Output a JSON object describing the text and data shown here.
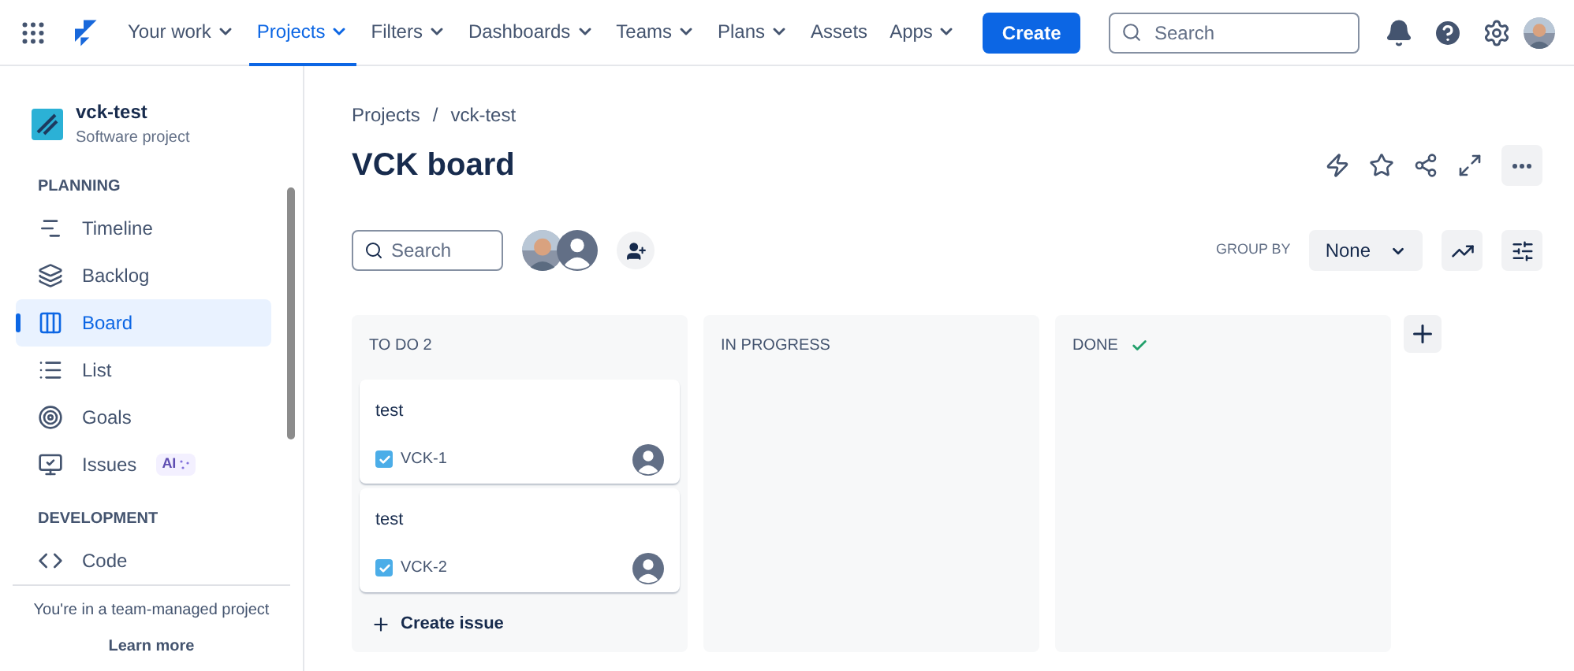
{
  "top_nav": {
    "items": [
      {
        "label": "Your work",
        "dropdown": true,
        "selected": false
      },
      {
        "label": "Projects",
        "dropdown": true,
        "selected": true
      },
      {
        "label": "Filters",
        "dropdown": true,
        "selected": false
      },
      {
        "label": "Dashboards",
        "dropdown": true,
        "selected": false
      },
      {
        "label": "Teams",
        "dropdown": true,
        "selected": false
      },
      {
        "label": "Plans",
        "dropdown": true,
        "selected": false
      },
      {
        "label": "Assets",
        "dropdown": false,
        "selected": false
      },
      {
        "label": "Apps",
        "dropdown": true,
        "selected": false
      }
    ],
    "create_button": "Create",
    "search": {
      "placeholder": "Search"
    }
  },
  "sidebar": {
    "project_name": "vck-test",
    "project_type": "Software project",
    "sections": [
      {
        "heading": "PLANNING",
        "items": [
          {
            "label": "Timeline",
            "selected": false
          },
          {
            "label": "Backlog",
            "selected": false
          },
          {
            "label": "Board",
            "selected": true
          },
          {
            "label": "List",
            "selected": false
          },
          {
            "label": "Goals",
            "selected": false
          },
          {
            "label": "Issues",
            "badge": "AI",
            "selected": false
          }
        ]
      },
      {
        "heading": "DEVELOPMENT",
        "items": [
          {
            "label": "Code",
            "selected": false
          }
        ]
      }
    ],
    "footer_text": "You're in a team-managed project",
    "footer_link": "Learn more"
  },
  "breadcrumbs": {
    "items": [
      "Projects",
      "vck-test"
    ],
    "separator": "/"
  },
  "board_title": "VCK board",
  "board_search": {
    "placeholder": "Search"
  },
  "group_by": {
    "label": "GROUP BY",
    "value": "None"
  },
  "columns": [
    {
      "title": "TO DO 2",
      "done": false,
      "cards": [
        {
          "title": "test",
          "key": "VCK-1",
          "checked": true
        },
        {
          "title": "test",
          "key": "VCK-2",
          "checked": true
        }
      ],
      "create_label": "Create issue"
    },
    {
      "title": "IN PROGRESS",
      "done": false
    },
    {
      "title": "DONE",
      "done": true
    }
  ]
}
